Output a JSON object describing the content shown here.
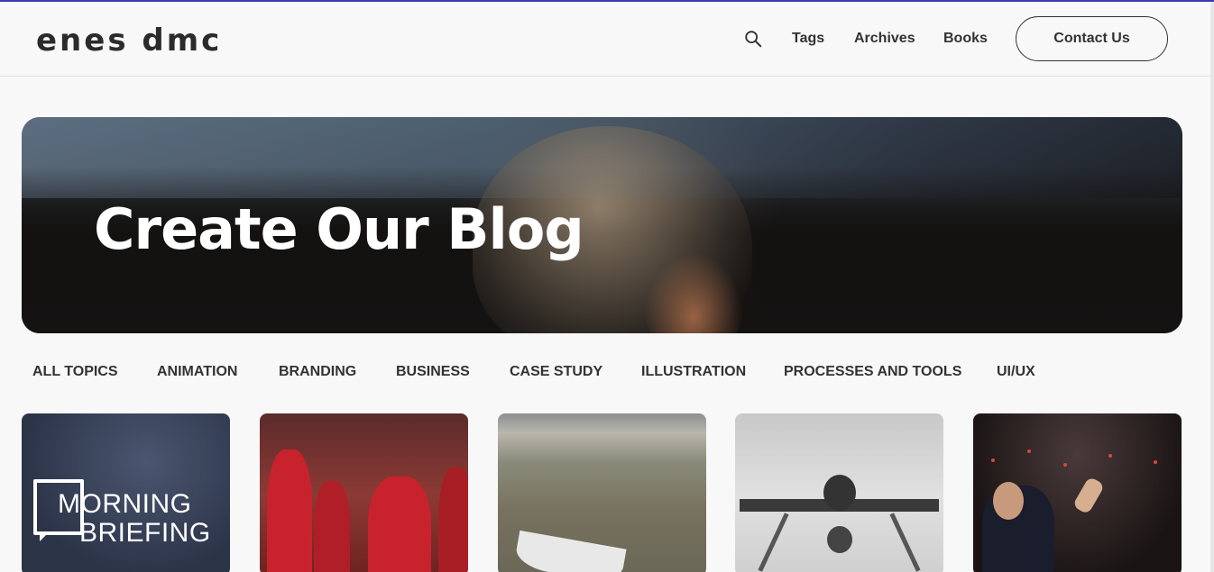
{
  "header": {
    "logo": "enes dmc",
    "nav": [
      "Tags",
      "Archives",
      "Books"
    ],
    "contact_label": "Contact Us"
  },
  "hero": {
    "title": "Create Our Blog"
  },
  "topics": [
    "ALL TOPICS",
    "ANIMATION",
    "BRANDING",
    "BUSINESS",
    "CASE STUDY",
    "ILLUSTRATION",
    "PROCESSES AND TOOLS",
    "UI/UX"
  ],
  "cards": [
    {
      "image": "morning-briefing-logo",
      "overlay_text": [
        "MORNING",
        "BRIEFING"
      ]
    },
    {
      "image": "football-players-photo"
    },
    {
      "image": "dry-lakebed-boat-photo"
    },
    {
      "image": "drone-photo"
    },
    {
      "image": "rally-speaker-photo"
    }
  ],
  "colors": {
    "top_accent": "#3b3bb8",
    "background": "#f8f8f8",
    "text": "#333333"
  },
  "icons": [
    "search-icon"
  ]
}
